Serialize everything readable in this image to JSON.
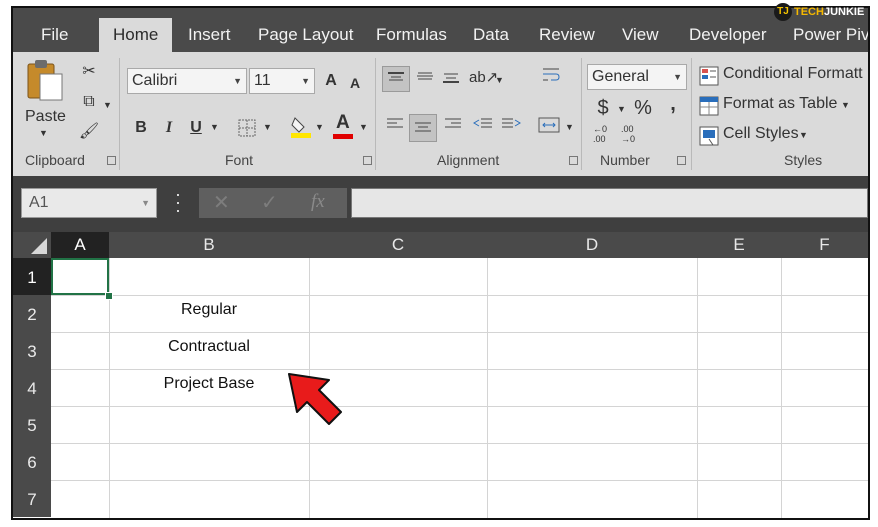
{
  "tabs": [
    "File",
    "Home",
    "Insert",
    "Page Layout",
    "Formulas",
    "Data",
    "Review",
    "View",
    "Developer",
    "Power Pivo"
  ],
  "watermark": {
    "mark": "TJ",
    "brand_a": "TECH",
    "brand_b": "JUNKIE"
  },
  "ribbon": {
    "clipboard": {
      "paste_label": "Paste",
      "group_label": "Clipboard"
    },
    "font": {
      "font_name": "Calibri",
      "font_size": "11",
      "grow": "A",
      "shrink": "A",
      "bold": "B",
      "italic": "I",
      "underline": "U",
      "font_color_letter": "A",
      "group_label": "Font"
    },
    "alignment": {
      "group_label": "Alignment"
    },
    "number": {
      "format": "General",
      "currency": "$",
      "percent": "%",
      "comma": ",",
      "inc_decimal_top": "←0",
      "inc_decimal_bottom": ".00",
      "dec_decimal_top": ".00",
      "dec_decimal_bottom": "→0",
      "group_label": "Number"
    },
    "styles": {
      "conditional_formatting": "Conditional Formatt",
      "format_as_table": "Format as Table",
      "cell_styles": "Cell Styles",
      "group_label": "Styles"
    }
  },
  "formula_bar": {
    "name_box": "A1",
    "fx": "fx",
    "formula": ""
  },
  "columns": [
    "A",
    "B",
    "C",
    "D",
    "E",
    "F"
  ],
  "rows": [
    "1",
    "2",
    "3",
    "4",
    "5",
    "6",
    "7"
  ],
  "cells": {
    "B2": "Regular",
    "B3": "Contractual",
    "B4": "Project Base"
  },
  "colors": {
    "accent_green": "#217346",
    "arrow_red": "#e81b1b",
    "font_color_red": "#e00000",
    "highlight_yellow": "#ffe600"
  }
}
